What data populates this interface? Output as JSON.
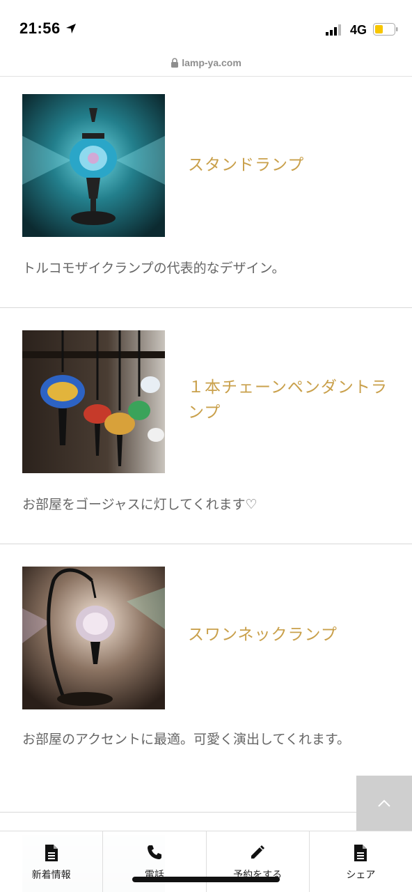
{
  "status": {
    "time": "21:56",
    "network": "4G",
    "battery_color": "#f7c600"
  },
  "url_bar": {
    "domain": "lamp-ya.com"
  },
  "items": [
    {
      "title": "スタンドランプ",
      "description": "トルコモザイクランプの代表的なデザイン。"
    },
    {
      "title": "１本チェーンペンダントランプ",
      "description": "お部屋をゴージャスに灯してくれます♡"
    },
    {
      "title": "スワンネックランプ",
      "description": "お部屋のアクセントに最適。可愛く演出してくれます。"
    }
  ],
  "bottom_nav": [
    {
      "label": "新着情報",
      "icon": "document-icon"
    },
    {
      "label": "電話",
      "icon": "phone-icon"
    },
    {
      "label": "予約をする",
      "icon": "pencil-icon"
    },
    {
      "label": "シェア",
      "icon": "document-icon"
    }
  ],
  "colors": {
    "accent": "#c9a04b"
  }
}
